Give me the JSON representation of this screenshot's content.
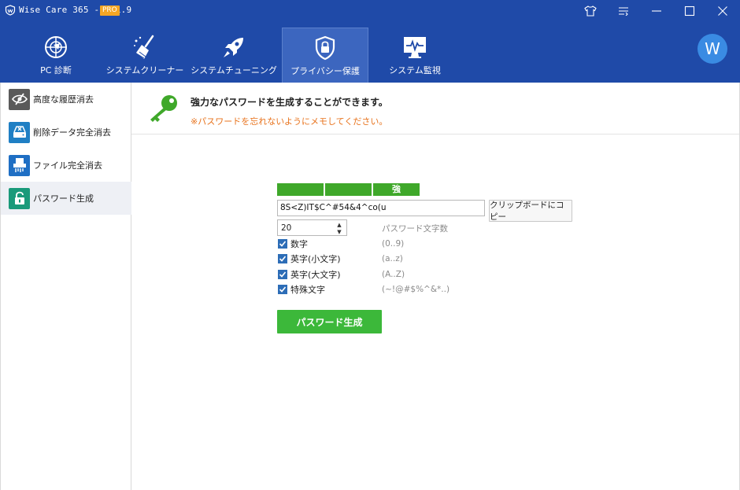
{
  "titlebar": {
    "title": "Wise Care 365 - 5.1.9",
    "badge": "PRO",
    "icons": [
      "tshirt-icon",
      "menu-icon",
      "minimize-icon",
      "maximize-icon",
      "close-icon"
    ]
  },
  "nav": {
    "tabs": [
      {
        "label": "PC 診断",
        "icon": "globe-target-icon"
      },
      {
        "label": "システムクリーナー",
        "icon": "broom-icon"
      },
      {
        "label": "システムチューニング",
        "icon": "rocket-icon"
      },
      {
        "label": "プライバシー保護",
        "icon": "shield-lock-icon",
        "active": true
      },
      {
        "label": "システム監視",
        "icon": "monitor-pulse-icon"
      }
    ],
    "avatar_letter": "W"
  },
  "sidebar": {
    "items": [
      {
        "label": "高度な履歴消去",
        "icon": "eye-slash-icon",
        "color": "#5a5a5a"
      },
      {
        "label": "削除データ完全消去",
        "icon": "disk-icon",
        "color": "#1f7fc4"
      },
      {
        "label": "ファイル完全消去",
        "icon": "shredder-icon",
        "color": "#1f6fc4"
      },
      {
        "label": "パスワード生成",
        "icon": "padlock-icon",
        "color": "#1a9a7a",
        "active": true
      }
    ]
  },
  "header": {
    "title": "強力なパスワードを生成することができます。",
    "note": "※パスワードを忘れないようにメモしてください。"
  },
  "generator": {
    "strength_label": "強",
    "strength_color": "#3fa82a",
    "password": "8S<Z)IT$C^#54&4^co(u",
    "copy_button": "クリップボードにコピー",
    "length": "20",
    "length_label": "パスワード文字数",
    "options": [
      {
        "label": "数字",
        "hint": "(0..9)",
        "checked": true
      },
      {
        "label": "英字(小文字)",
        "hint": "(a..z)",
        "checked": true
      },
      {
        "label": "英字(大文字)",
        "hint": "(A..Z)",
        "checked": true
      },
      {
        "label": "特殊文字",
        "hint": "(~!@#$%^&*..)",
        "checked": true
      }
    ],
    "generate_button": "パスワード生成"
  }
}
